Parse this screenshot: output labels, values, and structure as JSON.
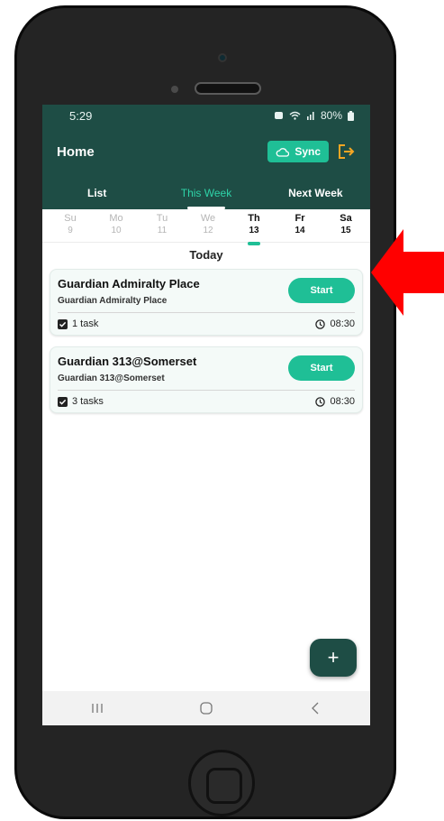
{
  "status_bar": {
    "time": "5:29",
    "battery": "80%"
  },
  "app_bar": {
    "title": "Home",
    "sync_label": "Sync"
  },
  "tabs": [
    {
      "label": "List",
      "active": false
    },
    {
      "label": "This Week",
      "active": true
    },
    {
      "label": "Next Week",
      "active": false
    }
  ],
  "days": [
    {
      "name": "Su",
      "num": "9"
    },
    {
      "name": "Mo",
      "num": "10"
    },
    {
      "name": "Tu",
      "num": "11"
    },
    {
      "name": "We",
      "num": "12"
    },
    {
      "name": "Th",
      "num": "13"
    },
    {
      "name": "Fr",
      "num": "14"
    },
    {
      "name": "Sa",
      "num": "15"
    }
  ],
  "section_title": "Today",
  "cards": [
    {
      "title": "Guardian Admiralty Place",
      "subtitle": "Guardian Admiralty Place",
      "action": "Start",
      "tasks": "1 task",
      "time": "08:30"
    },
    {
      "title": "Guardian 313@Somerset",
      "subtitle": "Guardian 313@Somerset",
      "action": "Start",
      "tasks": "3 tasks",
      "time": "08:30"
    }
  ],
  "fab_label": "+",
  "colors": {
    "primary": "#1e4d45",
    "accent": "#1fbf96",
    "logout": "#f5a623",
    "pointer": "#ff0000"
  },
  "icons": [
    "alarm-icon",
    "wifi-icon",
    "signal-icon",
    "battery-icon",
    "cloud-icon",
    "logout-icon",
    "checkbox-icon",
    "clock-icon",
    "recents-icon",
    "home-icon",
    "back-icon",
    "red-arrow-icon"
  ]
}
